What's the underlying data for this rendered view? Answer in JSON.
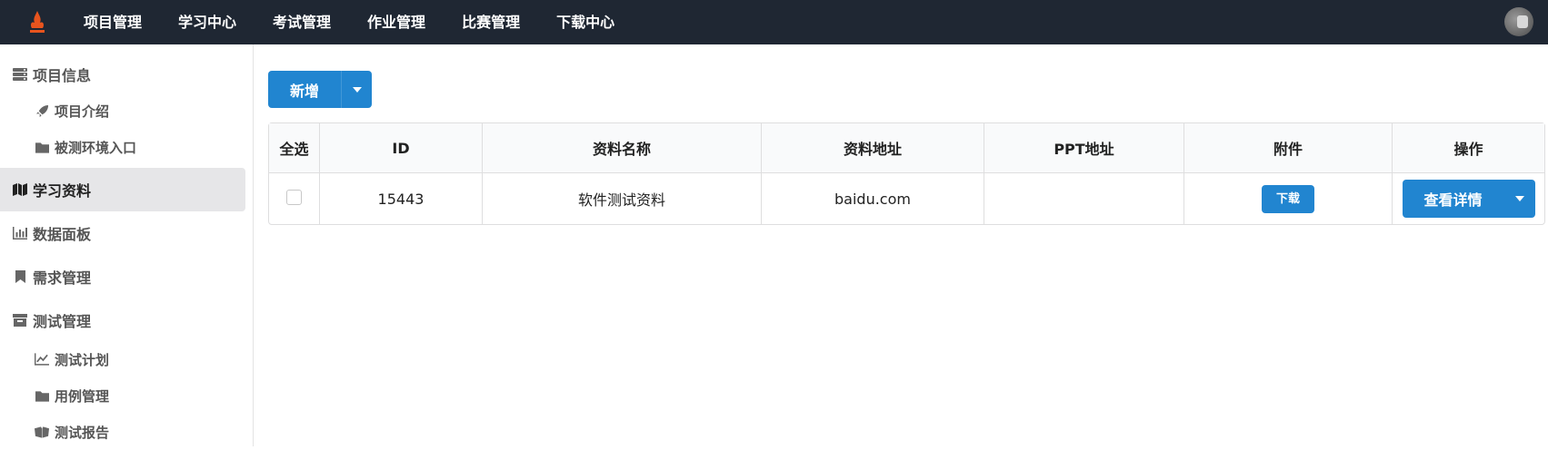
{
  "nav": {
    "items": [
      "项目管理",
      "学习中心",
      "考试管理",
      "作业管理",
      "比赛管理",
      "下载中心"
    ]
  },
  "sidebar": {
    "items": [
      {
        "label": "项目信息",
        "icon": "server-icon"
      },
      {
        "label": "项目介绍",
        "icon": "rocket-icon"
      },
      {
        "label": "被测环境入口",
        "icon": "folder-icon"
      },
      {
        "label": "学习资料",
        "icon": "map-icon"
      },
      {
        "label": "数据面板",
        "icon": "bar-chart-icon"
      },
      {
        "label": "需求管理",
        "icon": "bookmark-icon"
      },
      {
        "label": "测试管理",
        "icon": "archive-icon"
      },
      {
        "label": "测试计划",
        "icon": "line-chart-icon"
      },
      {
        "label": "用例管理",
        "icon": "folder-icon"
      },
      {
        "label": "测试报告",
        "icon": "book-icon"
      }
    ]
  },
  "toolbar": {
    "add_label": "新增"
  },
  "table": {
    "headers": [
      "全选",
      "ID",
      "资料名称",
      "资料地址",
      "PPT地址",
      "附件",
      "操作"
    ],
    "rows": [
      {
        "id": "15443",
        "name": "软件测试资料",
        "address": "baidu.com",
        "ppt": "",
        "download_label": "下载",
        "detail_label": "查看详情"
      }
    ]
  },
  "colors": {
    "primary": "#2185d0",
    "topbar": "#1f2733",
    "active_bg": "#e6e6e8"
  }
}
